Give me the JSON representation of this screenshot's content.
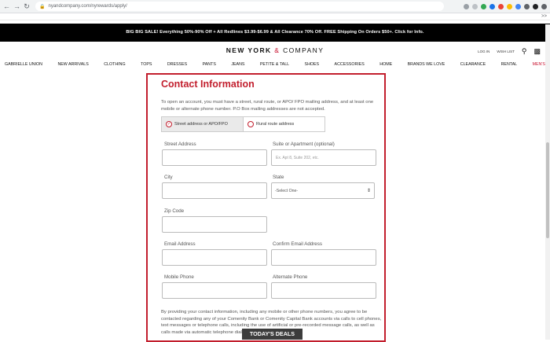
{
  "browser": {
    "url": "nyandcompany.com/nyrewards/apply/",
    "back_icon": "arrow-left",
    "forward_icon": "arrow-right",
    "reload_icon": "reload",
    "bookmark_bar_glyph": ">>"
  },
  "promo": {
    "text": "BIG BIG SALE! Everything 50%-90% Off + All Redlines $3.99-$6.99 & All Clearance 70% Off. FREE Shipping On Orders $50+. Click for Info."
  },
  "header": {
    "logo_main": "NEW YORK",
    "logo_amp": "&",
    "logo_company": "COMPANY",
    "login": "LOG IN",
    "wishlist": "WISH LIST"
  },
  "menu": {
    "items": [
      "GABRIELLE UNION",
      "NEW ARRIVALS",
      "CLOTHING",
      "TOPS",
      "DRESSES",
      "PANTS",
      "JEANS",
      "PETITE & TALL",
      "SHOES",
      "ACCESSORIES",
      "HOME",
      "BRANDS WE LOVE",
      "CLEARANCE",
      "RENTAL",
      "MEN'S"
    ],
    "accent": "#c8102e"
  },
  "form": {
    "title": "Contact Information",
    "intro": "To open an account, you must have a street, rural route, or APO/ FPO mailing address, and at least one mobile or alternate phone number. P.O Box mailing addresses are not accepted.",
    "tabs": {
      "street": "Street address or APO/FPO",
      "rural": "Rural route address"
    },
    "fields": {
      "street_label": "Street Address",
      "suite_label": "Suite or Apartment (optional)",
      "suite_placeholder": "Ex. Apt 8, Suite 202, etc.",
      "city_label": "City",
      "state_label": "State",
      "state_value": "-Select One-",
      "zip_label": "Zip Code",
      "email_label": "Email Address",
      "confirm_email_label": "Confirm Email Address",
      "mobile_label": "Mobile Phone",
      "alt_phone_label": "Alternate Phone"
    },
    "consent": "By providing your contact information, including any mobile or other phone numbers, you agree to be contacted regarding any of your Comenity Bank or Comenity Capital Bank accounts via calls to cell phones, text messages or telephone calls, including the use of artificial or pre-recorded message calls, as well as calls made via automatic telephone dialing systems or via email.",
    "border_color": "#c21e2d"
  },
  "deals_button": "TODAY'S DEALS"
}
